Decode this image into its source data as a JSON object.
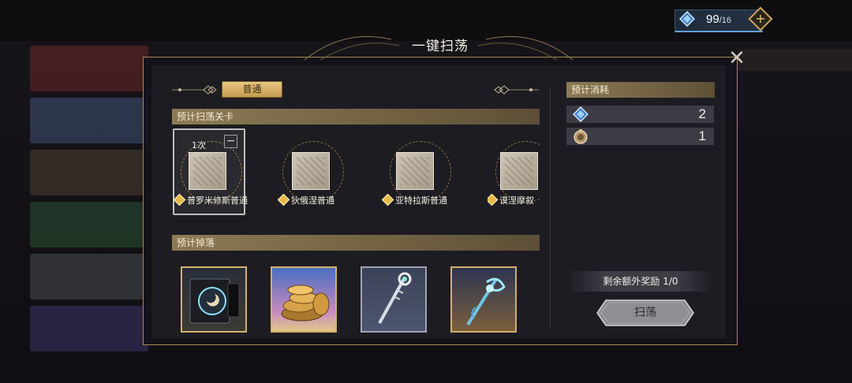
{
  "window": {
    "title": "一键扫荡"
  },
  "stamina": {
    "current": "99",
    "max": "/16",
    "icon": "stamina-gem-icon"
  },
  "tabs": [
    {
      "label": "普通",
      "active": true
    }
  ],
  "sections": {
    "stages_header": "预计扫荡关卡",
    "drops_header": "预计掉落",
    "cost_header": "预计消耗"
  },
  "stages": [
    {
      "name": "普罗米修斯普通",
      "count": "1次",
      "selected": true
    },
    {
      "name": "狄俄涅普通"
    },
    {
      "name": "亚特拉斯普通"
    },
    {
      "name": "谟涅摩叙"
    }
  ],
  "drops": [
    {
      "icon": "emblem-icon",
      "rarity": "gold"
    },
    {
      "icon": "coins-icon",
      "rarity": "gold"
    },
    {
      "icon": "silver-staff-icon",
      "rarity": "silver"
    },
    {
      "icon": "blue-staff-icon",
      "rarity": "gold"
    }
  ],
  "costs": [
    {
      "icon": "stamina-gem-icon",
      "value": "2"
    },
    {
      "icon": "ticket-icon",
      "value": "1"
    }
  ],
  "bonus_text": "剩余额外奖励  1/0",
  "sweep_button": "扫荡",
  "colors": {
    "gold": "#c9a45c",
    "header": "#8c7a55",
    "accent_blue": "#5fa3d8"
  }
}
